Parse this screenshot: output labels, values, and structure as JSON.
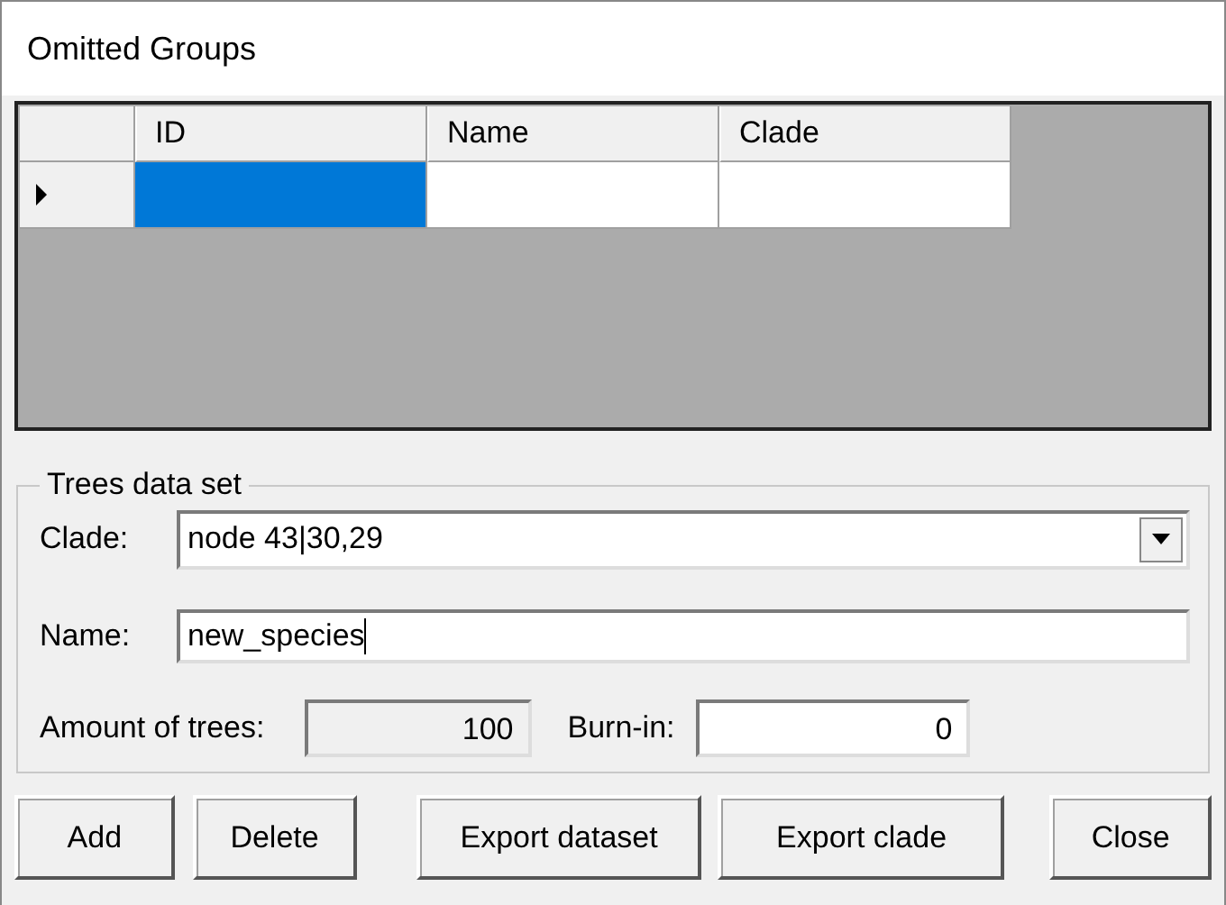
{
  "window": {
    "title": "Omitted Groups"
  },
  "grid": {
    "columns": [
      "ID",
      "Name",
      "Clade"
    ],
    "rows": [
      {
        "current": true,
        "cells": [
          {
            "selected": true
          },
          {
            "selected": false
          },
          {
            "selected": false
          }
        ]
      }
    ]
  },
  "group": {
    "title": "Trees data set",
    "fields": [
      {
        "kind": "combo",
        "label": "Clade:",
        "value": "node 43|30,29"
      },
      {
        "kind": "text",
        "label": "Name:",
        "value": "new_species",
        "focused": true
      }
    ],
    "amount": {
      "label": "Amount of trees:",
      "value": "100",
      "disabled": true
    },
    "burnin": {
      "label": "Burn-in:",
      "value": "0",
      "disabled": false
    }
  },
  "buttons": [
    "Add",
    "Delete",
    "Export dataset",
    "Export clade",
    "Close"
  ]
}
